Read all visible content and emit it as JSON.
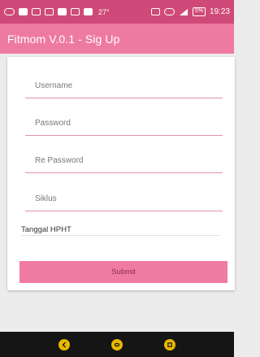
{
  "status_bar": {
    "temperature": "27°",
    "battery": "5%",
    "time": "19:23",
    "icons": [
      "chat-icon",
      "notification-icon",
      "gallery-icon",
      "mail-icon",
      "video-icon",
      "image-icon",
      "message-icon",
      "vibrate-icon",
      "alarm-icon",
      "lte-signal-icon",
      "battery-icon"
    ]
  },
  "app_bar": {
    "title": "Fitmom V.0.1 - Sig Up"
  },
  "form": {
    "username_placeholder": "Username",
    "password_placeholder": "Password",
    "repassword_placeholder": "Re Password",
    "siklus_placeholder": "Siklus",
    "hpht_label": "Tanggal HPHT",
    "submit_label": "Submit"
  },
  "nav_bar": {
    "icons": [
      "back-icon",
      "home-icon",
      "recents-icon"
    ]
  },
  "colors": {
    "status_bar": "#cf4a78",
    "app_bar": "#ee7aa2",
    "field_underline": "#e58fb0",
    "submit_bg": "#ef7ba3",
    "submit_text": "#8b2b52",
    "nav_bar": "#151515",
    "nav_button": "#e8b800"
  }
}
